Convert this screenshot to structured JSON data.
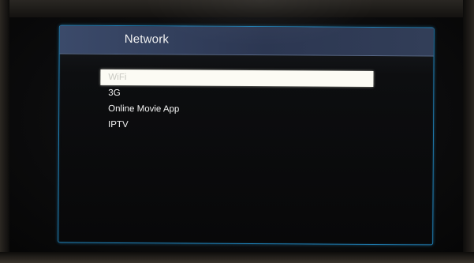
{
  "header": {
    "title": "Network"
  },
  "menu": {
    "items": [
      {
        "label": "WiFi",
        "selected": true
      },
      {
        "label": "3G",
        "selected": false
      },
      {
        "label": "Online Movie App",
        "selected": false
      },
      {
        "label": "IPTV",
        "selected": false
      }
    ]
  },
  "colors": {
    "accent_border": "#1f7cb0",
    "header_bg": "#34405c",
    "selection_bg": "#fcfbf4",
    "text": "#f4f4f4"
  }
}
